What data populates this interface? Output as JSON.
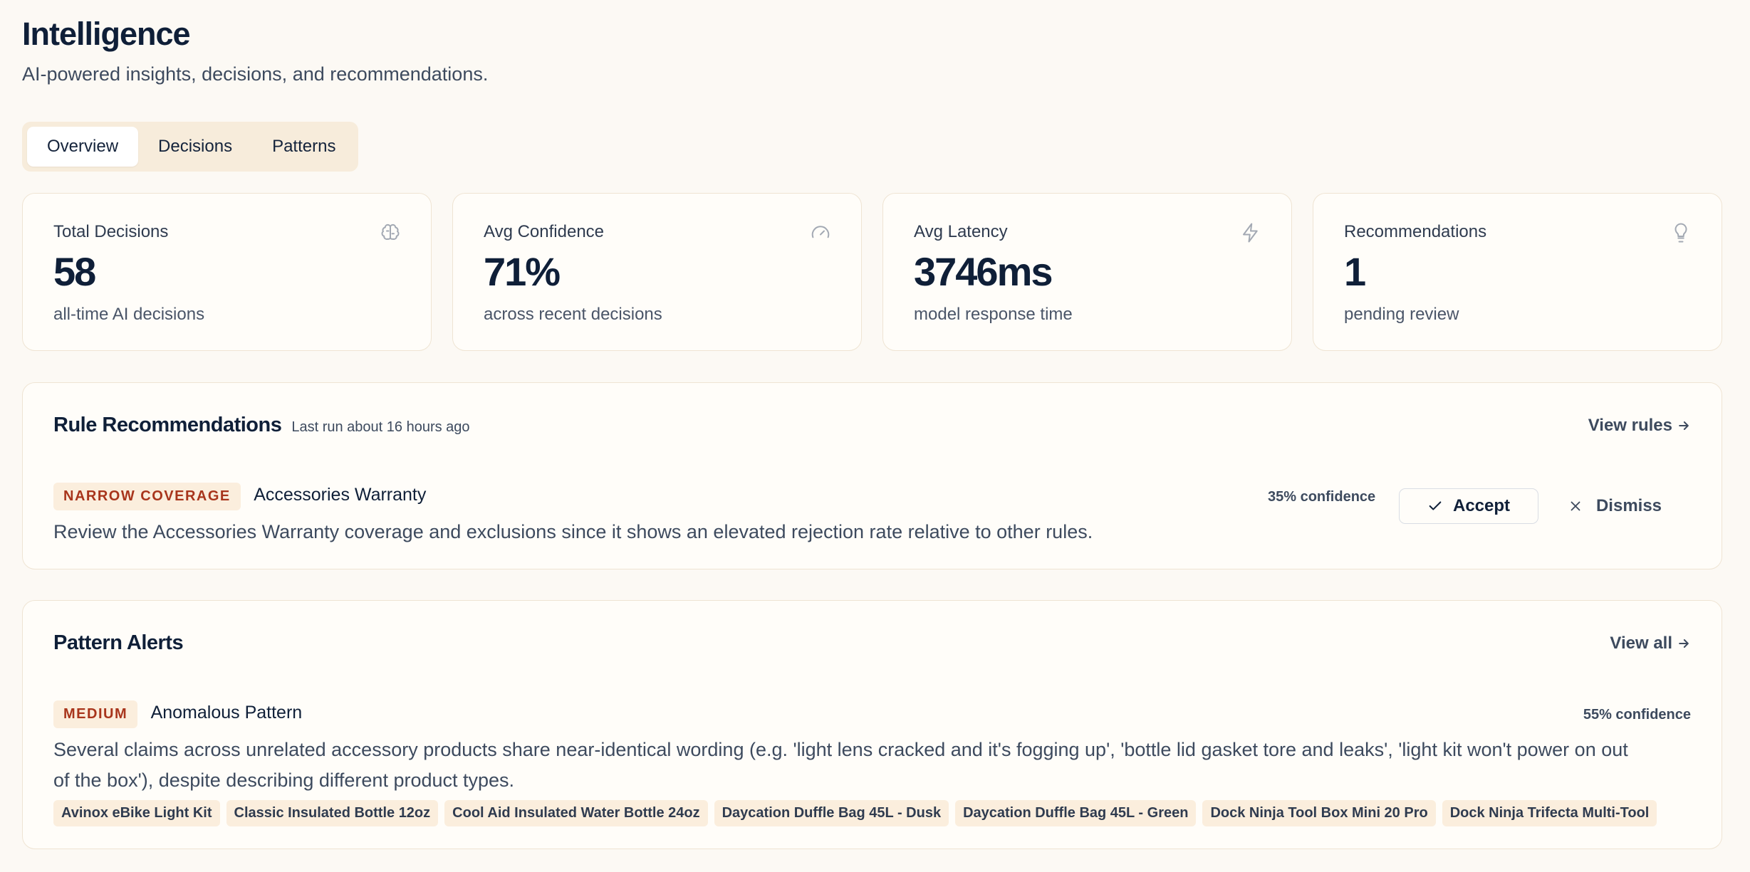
{
  "header": {
    "title": "Intelligence",
    "subtitle": "AI-powered insights, decisions, and recommendations."
  },
  "tabs": [
    {
      "label": "Overview",
      "active": true
    },
    {
      "label": "Decisions",
      "active": false
    },
    {
      "label": "Patterns",
      "active": false
    }
  ],
  "stats": [
    {
      "label": "Total Decisions",
      "value": "58",
      "description": "all-time AI decisions",
      "icon": "brain-icon"
    },
    {
      "label": "Avg Confidence",
      "value": "71%",
      "description": "across recent decisions",
      "icon": "gauge-icon"
    },
    {
      "label": "Avg Latency",
      "value": "3746ms",
      "description": "model response time",
      "icon": "lightning-icon"
    },
    {
      "label": "Recommendations",
      "value": "1",
      "description": "pending review",
      "icon": "lightbulb-icon"
    }
  ],
  "rule_recommendations": {
    "title": "Rule Recommendations",
    "meta": "Last run about 16 hours ago",
    "link": "View rules",
    "item": {
      "badge": "NARROW COVERAGE",
      "title": "Accessories Warranty",
      "description": "Review the Accessories Warranty coverage and exclusions since it shows an elevated rejection rate relative to other rules.",
      "confidence": "35% confidence",
      "accept_label": "Accept",
      "dismiss_label": "Dismiss"
    }
  },
  "pattern_alerts": {
    "title": "Pattern Alerts",
    "link": "View all",
    "item": {
      "badge": "MEDIUM",
      "title": "Anomalous Pattern",
      "description_line1": "Several claims across unrelated accessory products share near-identical wording (e.g. 'light lens cracked and it's fogging up', 'bottle lid gasket tore and leaks', 'light kit won't power on out",
      "description_line2": "of the box'), despite describing different product types.",
      "confidence": "55% confidence",
      "tags": [
        "Avinox eBike Light Kit",
        "Classic Insulated Bottle 12oz",
        "Cool Aid Insulated Water Bottle 24oz",
        "Daycation Duffle Bag 45L - Dusk",
        "Daycation Duffle Bag 45L - Green",
        "Dock Ninja Tool Box Mini 20 Pro",
        "Dock Ninja Trifecta Multi-Tool"
      ]
    }
  },
  "colors": {
    "background": "#fcf9f4",
    "badge_bg": "#fbeedd",
    "badge_text": "#a8351c",
    "heading": "#0f1f38"
  }
}
